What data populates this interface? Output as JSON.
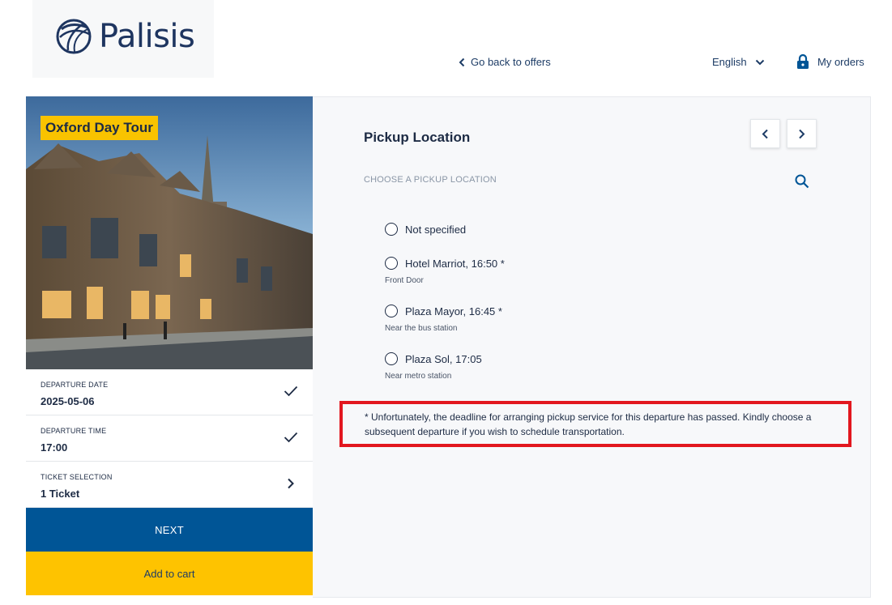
{
  "header": {
    "brand": "Palisis",
    "back_link": "Go back to offers",
    "language": "English",
    "orders_link": "My orders"
  },
  "tour": {
    "title": "Oxford Day Tour"
  },
  "summary": [
    {
      "label": "DEPARTURE DATE",
      "value": "2025-05-06",
      "icon": "check-icon"
    },
    {
      "label": "DEPARTURE TIME",
      "value": "17:00",
      "icon": "check-icon"
    },
    {
      "label": "TICKET SELECTION",
      "value": "1 Ticket",
      "icon": "chevron-right-icon"
    }
  ],
  "actions": {
    "next_label": "NEXT",
    "cart_label": "Add to cart"
  },
  "pickup": {
    "title": "Pickup Location",
    "choose_label": "CHOOSE A PICKUP LOCATION",
    "options": [
      {
        "label": "Not specified",
        "sub": ""
      },
      {
        "label": "Hotel Marriot, 16:50 *",
        "sub": "Front Door"
      },
      {
        "label": "Plaza Mayor, 16:45 *",
        "sub": "Near the bus station"
      },
      {
        "label": "Plaza Sol, 17:05",
        "sub": "Near metro station"
      }
    ],
    "notice": "* Unfortunately, the deadline for arranging pickup service for this departure has passed. Kindly choose a subsequent departure if you wish to schedule transportation."
  },
  "colors": {
    "primary": "#005596",
    "accent": "#fec300",
    "notice_border": "#e2171f",
    "text": "#1d2b44"
  }
}
